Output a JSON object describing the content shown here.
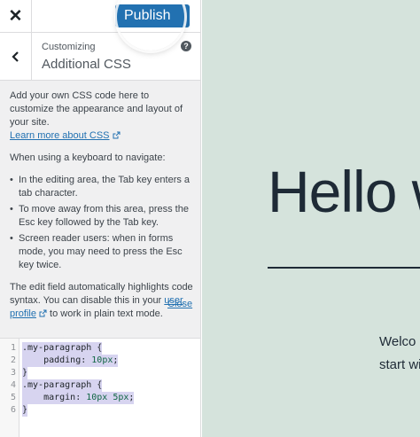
{
  "topbar": {
    "close_icon": "close-icon",
    "publish_label": "Publish"
  },
  "section": {
    "crumb": "Customizing",
    "title": "Additional CSS",
    "back_icon": "chevron-left-icon",
    "help_icon": "help-icon"
  },
  "description": {
    "intro": "Add your own CSS code here to customize the appearance and layout of your site.",
    "learn_more_link": "Learn more about CSS",
    "keyboard_heading": "When using a keyboard to navigate:",
    "bullets": [
      "In the editing area, the Tab key enters a tab character.",
      "To move away from this area, press the Esc key followed by the Tab key.",
      "Screen reader users: when in forms mode, you may need to press the Esc key twice."
    ],
    "highlight_text_before": "The edit field automatically highlights code syntax. You can disable this in your ",
    "user_profile_link": "user profile",
    "highlight_text_after": " to work in plain text mode.",
    "close_link": "Close"
  },
  "editor": {
    "line_numbers": [
      "1",
      "2",
      "3",
      "4",
      "5",
      "6"
    ],
    "lines": [
      {
        "selector": ".my-paragraph",
        "rest": " {"
      },
      {
        "property": "    padding: ",
        "value": "10px",
        "rest": ";"
      },
      {
        "rest": "}"
      },
      {
        "selector": ".my-paragraph",
        "rest": " {"
      },
      {
        "property": "    margin: ",
        "value": "10px 5px",
        "rest": ";"
      },
      {
        "rest": "}"
      }
    ]
  },
  "preview": {
    "heading": "Hello w",
    "body_line_1": "Welco",
    "body_line_2": "start wi",
    "background_color": "#d5e3dc"
  }
}
